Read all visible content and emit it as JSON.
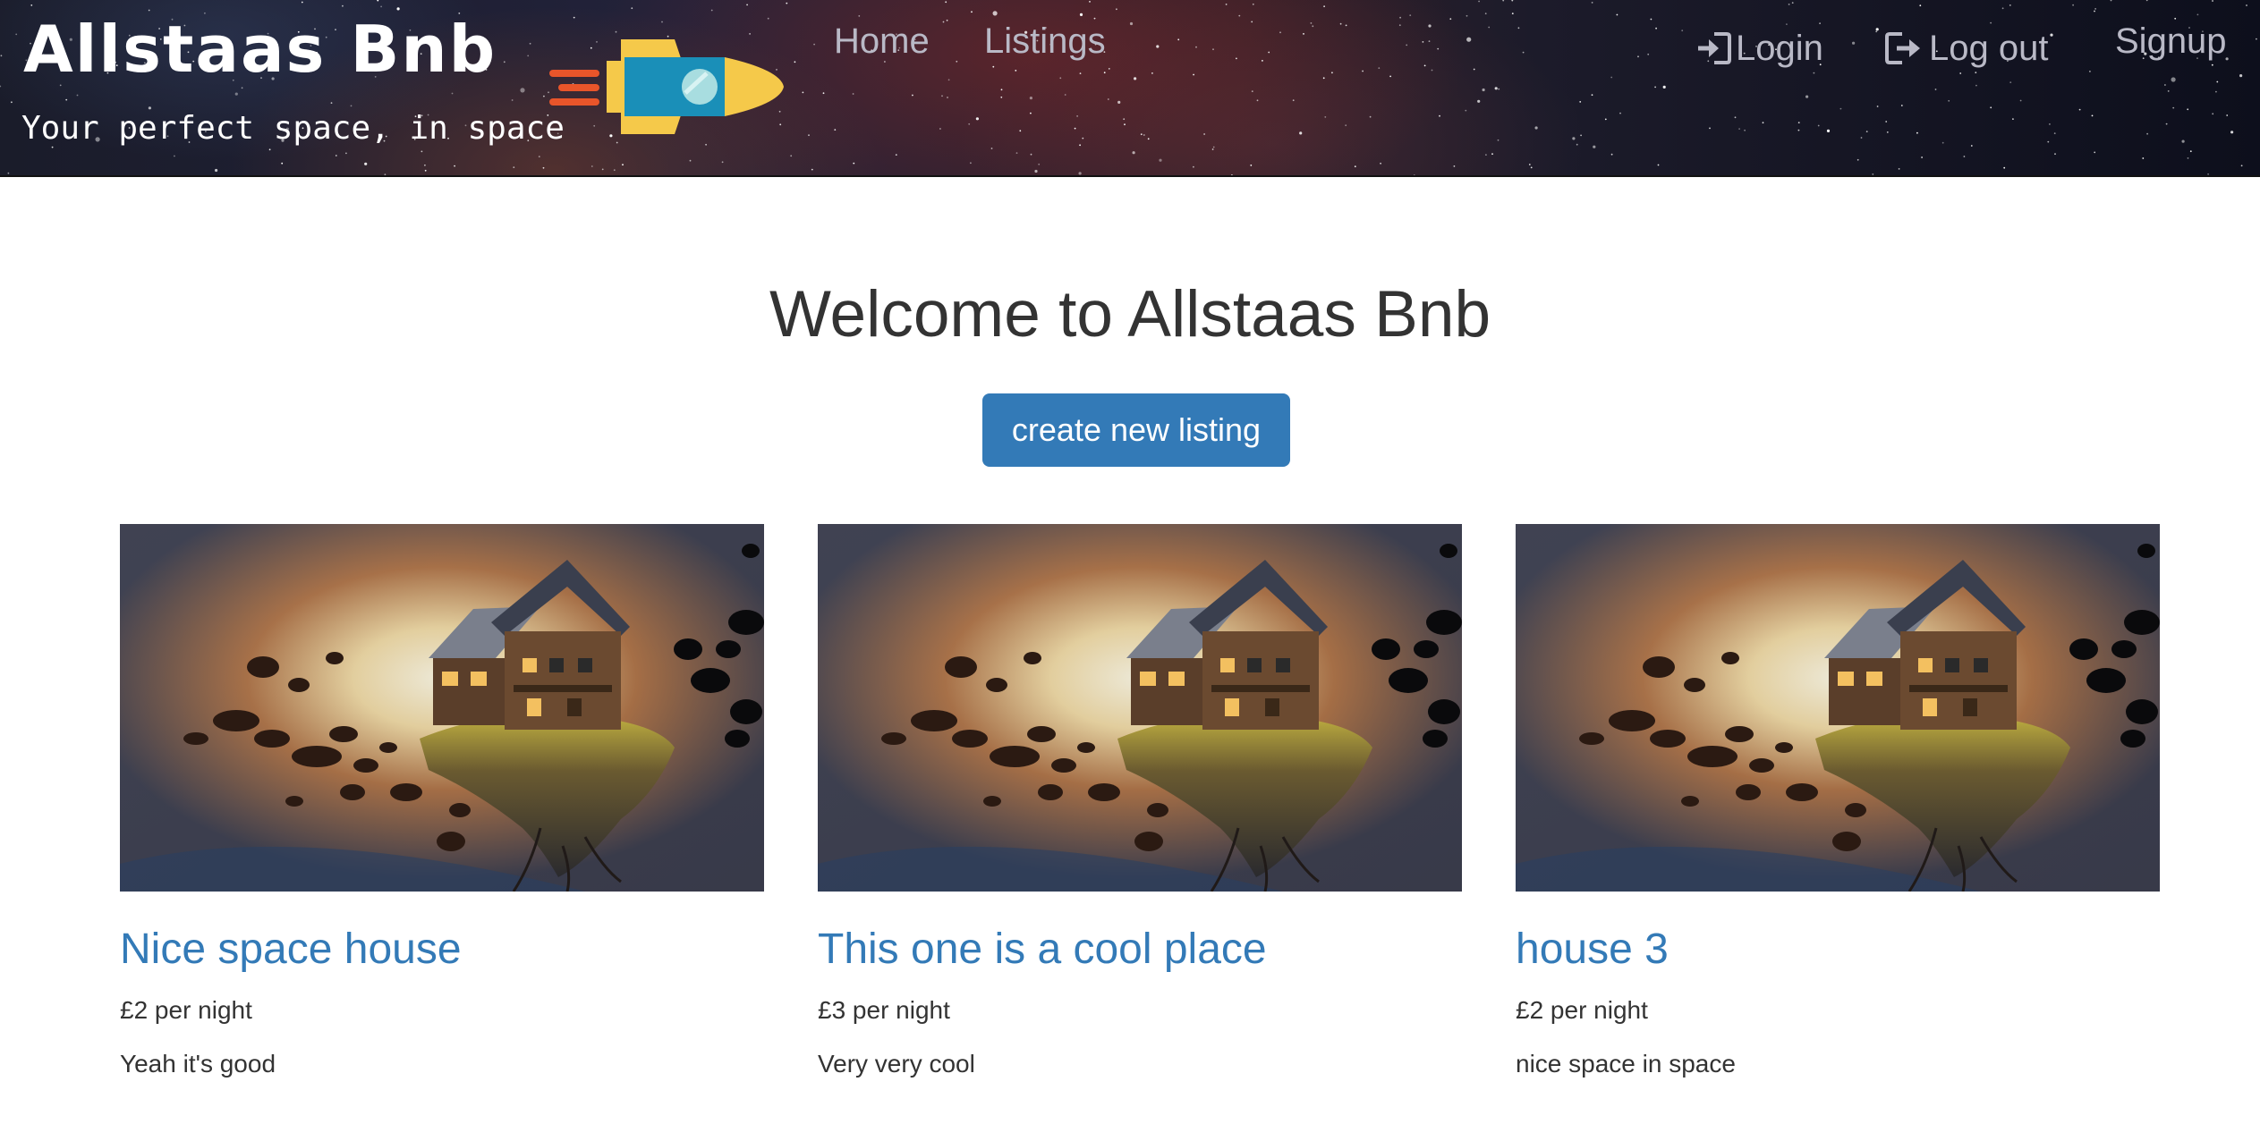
{
  "brand": {
    "title": "Allstaas Bnb",
    "tagline": "Your perfect space, in space",
    "logo_icon": "rocket-icon"
  },
  "nav": {
    "home": "Home",
    "listings": "Listings",
    "login": "Login",
    "login_icon": "login-icon",
    "logout": "Log out",
    "logout_icon": "logout-icon",
    "signup": "Signup"
  },
  "main": {
    "heading": "Welcome to Allstaas Bnb",
    "create_button": "create new listing"
  },
  "listings": [
    {
      "title": "Nice space house",
      "price": "£2 per night",
      "description": "Yeah it's good"
    },
    {
      "title": "This one is a cool place",
      "price": "£3 per night",
      "description": "Very very cool"
    },
    {
      "title": "house 3",
      "price": "£2 per night",
      "description": "nice space in space"
    }
  ],
  "colors": {
    "link": "#337ab7",
    "button": "#337ab7",
    "text": "#333333",
    "nav_text": "#b9b9c6"
  }
}
